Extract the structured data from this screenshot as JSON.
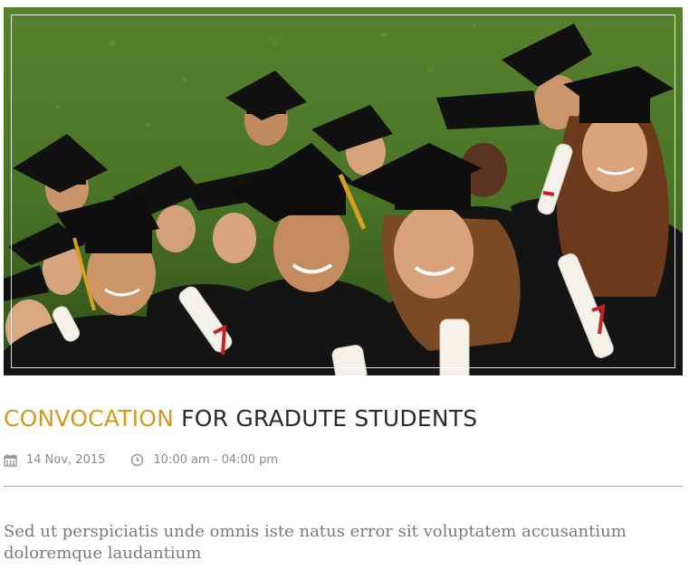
{
  "event": {
    "image_alt": "Graduating students in caps and gowns",
    "title_highlight": "CONVOCATION",
    "title_rest": "FOR GRADUTE STUDENTS",
    "date_icon": "calendar-icon",
    "date": "14 Nov, 2015",
    "time_icon": "clock-icon",
    "time": "10:00 am - 04:00 pm",
    "excerpt": "Sed ut perspiciatis unde omnis iste natus error sit voluptatem accusantium doloremque laudantium"
  },
  "colors": {
    "accent": "#d49a1f",
    "title": "#2b2b2b",
    "meta": "#8a8a8a",
    "divider": "#d2a94e",
    "excerpt": "#7a7a7a",
    "gown": "#161616",
    "grass": "#4d7a2a"
  }
}
